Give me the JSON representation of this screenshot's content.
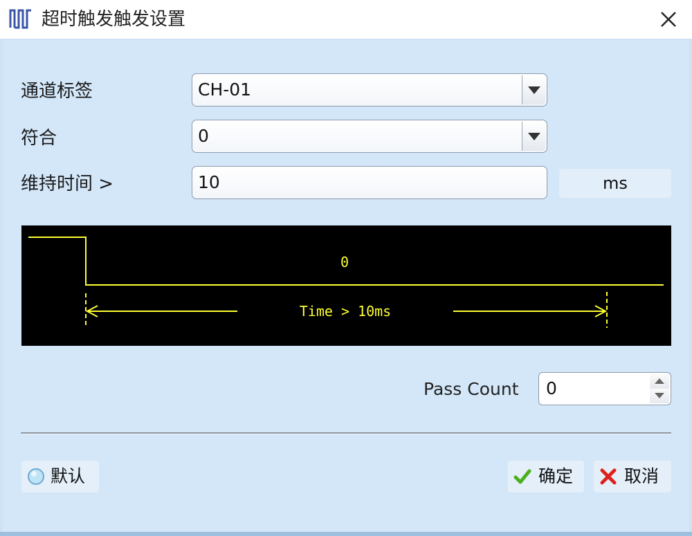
{
  "window": {
    "title": "超时触发触发设置"
  },
  "form": {
    "channel": {
      "label": "通道标签",
      "value": "CH-01"
    },
    "match": {
      "label": "符合",
      "value": "0"
    },
    "duration": {
      "label": "维持时间 >",
      "value": "10",
      "unit": "ms"
    }
  },
  "diagram": {
    "level_label": "0",
    "time_label": "Time > 10ms"
  },
  "pass_count": {
    "label": "Pass Count",
    "value": "0"
  },
  "buttons": {
    "default": "默认",
    "ok": "确定",
    "cancel": "取消"
  },
  "colors": {
    "dialog_bg": "#d3e7f9",
    "waveform": "#ffff33",
    "scope_bg": "#000000",
    "ok_check": "#4caf1e",
    "cancel_x": "#e0201c"
  }
}
